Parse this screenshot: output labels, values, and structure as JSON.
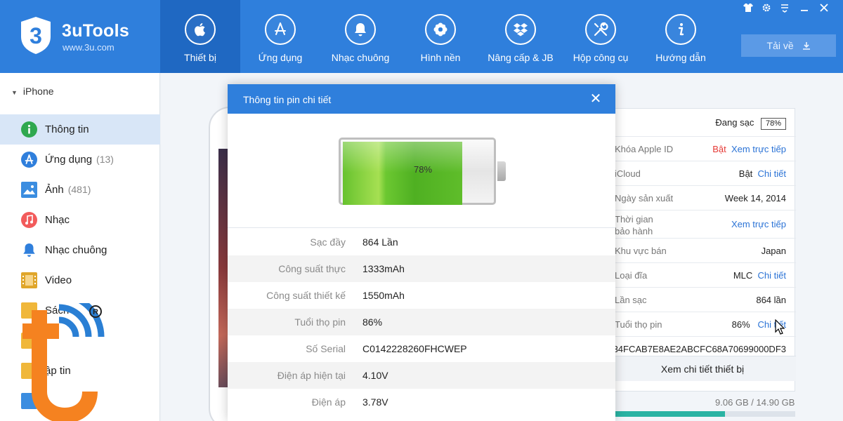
{
  "app": {
    "name": "3uTools",
    "url": "www.3u.com",
    "download_label": "Tải về"
  },
  "nav": [
    {
      "label": "Thiết bị",
      "icon": "apple-icon"
    },
    {
      "label": "Ứng dụng",
      "icon": "app-store-icon"
    },
    {
      "label": "Nhạc chuông",
      "icon": "bell-icon"
    },
    {
      "label": "Hình nền",
      "icon": "flower-icon"
    },
    {
      "label": "Nâng cấp & JB",
      "icon": "dropbox-icon"
    },
    {
      "label": "Hộp công cụ",
      "icon": "tools-icon"
    },
    {
      "label": "Hướng dẫn",
      "icon": "info-icon"
    }
  ],
  "sidebar": {
    "device": "iPhone",
    "items": [
      {
        "label": "Thông tin",
        "count": "",
        "color": "#2fa84f"
      },
      {
        "label": "Ứng dụng",
        "count": "(13)",
        "color": "#2f7fdc"
      },
      {
        "label": "Ảnh",
        "count": "(481)",
        "color": "#3b8de0"
      },
      {
        "label": "Nhạc",
        "count": "",
        "color": "#f25b5b"
      },
      {
        "label": "Nhạc chuông",
        "count": "",
        "color": "#2f7fdc"
      },
      {
        "label": "Video",
        "count": "",
        "color": "#e0a62b"
      },
      {
        "label": "Sách",
        "count": "",
        "color": "#f0b73a"
      },
      {
        "label": "",
        "count": "",
        "color": "#f0b73a"
      },
      {
        "label": "ập tin",
        "count": "",
        "color": "#f0b73a"
      },
      {
        "label": "",
        "count": "",
        "color": "#3b8de0"
      }
    ]
  },
  "info": {
    "charging_label": "Đang sạc",
    "charging_value": "78%",
    "rows": [
      {
        "label": "Khóa Apple ID",
        "value": "Bật",
        "link": "Xem trực tiếp",
        "value_color": "#e53935"
      },
      {
        "label": "iCloud",
        "value": "Bật",
        "link": "Chi tiết",
        "value_color": ""
      },
      {
        "label": "Ngày sản xuất",
        "value": "Week 14, 2014",
        "link": "",
        "value_color": ""
      },
      {
        "label": "Thời gian bảo hành",
        "value": "",
        "link": "Xem trực tiếp",
        "value_color": ""
      },
      {
        "label": "Khu vực bán",
        "value": "Japan",
        "link": "",
        "value_color": ""
      },
      {
        "label": "Loại đĩa",
        "value": "MLC",
        "link": "Chi tiết",
        "value_color": ""
      },
      {
        "label": "Lần sạc",
        "value": "864 lần",
        "link": "",
        "value_color": ""
      },
      {
        "label": "Tuổi thọ pin",
        "value": "86%",
        "link": "Chi tiết",
        "value_color": ""
      }
    ],
    "serial_hash": "34FCAB7E8AE2ABCFC68A70699000DF3",
    "detail_button": "Xem chi tiết thiết bị",
    "storage": "9.06 GB / 14.90 GB",
    "storage_fraction": 0.61
  },
  "dialog": {
    "title": "Thông tin pin chi tiết",
    "battery_percent": "78%",
    "battery_level": 0.78,
    "rows": [
      {
        "label": "Sạc đầy",
        "value": "864 Lần"
      },
      {
        "label": "Công suất thực",
        "value": "1333mAh"
      },
      {
        "label": "Công suất thiết kế",
        "value": "1550mAh"
      },
      {
        "label": "Tuổi thọ pin",
        "value": "86%"
      },
      {
        "label": "Số Serial",
        "value": "C0142228260FHCWEP"
      },
      {
        "label": "Điện áp hiện tại",
        "value": "4.10V"
      },
      {
        "label": "Điện áp",
        "value": "3.78V"
      }
    ]
  }
}
